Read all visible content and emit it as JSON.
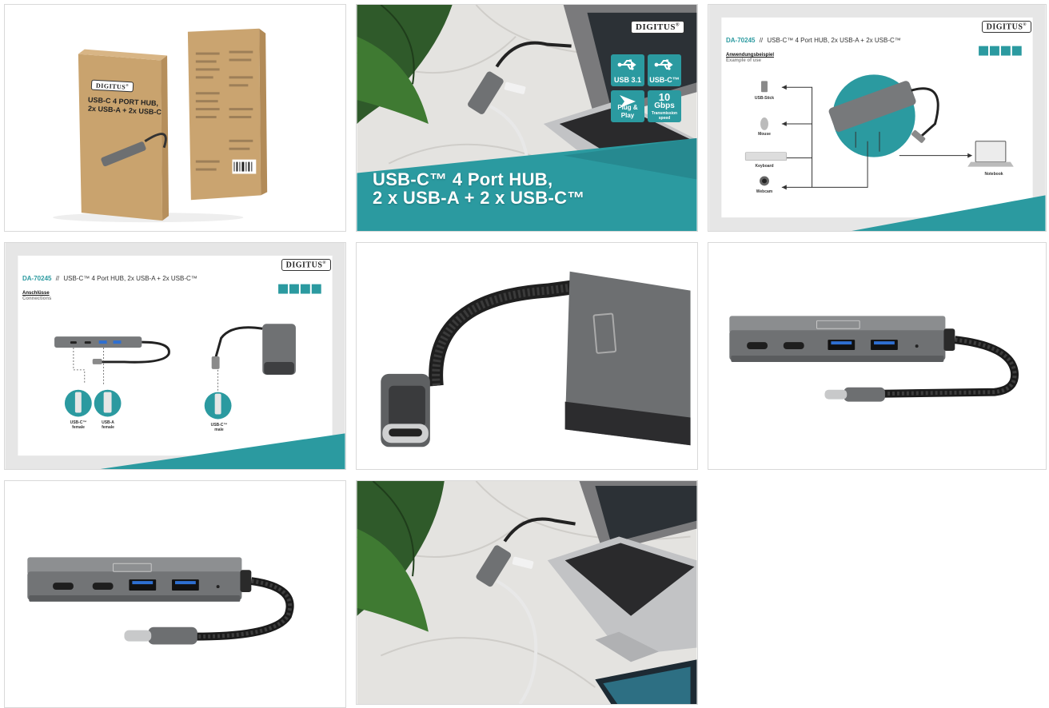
{
  "gallery": {
    "brand": "DIGITUS",
    "tile1": {
      "box_logo": "DIGITUS",
      "box_title": "USB-C 4 PORT HUB,",
      "box_subtitle": "2x USB-A + 2x USB-C"
    },
    "tile2": {
      "headline_line1": "USB-C™ 4 Port HUB,",
      "headline_line2": "2 x USB-A + 2 x USB-C™",
      "badges": [
        {
          "label": "USB 3.1",
          "icon": "usb-icon"
        },
        {
          "label": "USB-C™",
          "icon": "usb-icon"
        },
        {
          "label": "Plug & Play",
          "icon": "plug-and-play-icon"
        },
        {
          "value": "10",
          "unit": "Gbps",
          "label": "Transmission speed"
        }
      ]
    },
    "tile3": {
      "model": "DA-70245",
      "separator": "//",
      "title": "USB-C™ 4 Port HUB, 2x USB-A + 2x USB-C™",
      "heading_de": "Anwendungsbeispiel",
      "heading_en": "Example of use",
      "devices": [
        "USB-Stick",
        "Mouse",
        "Keyboard",
        "Webcam"
      ],
      "host": "Notebook"
    },
    "tile4": {
      "model": "DA-70245",
      "separator": "//",
      "title": "USB-C™ 4 Port HUB, 2x USB-A + 2x USB-C™",
      "heading_de": "Anschlüsse",
      "heading_en": "Connections",
      "connectors": [
        {
          "line1": "USB-C™",
          "line2": "female"
        },
        {
          "line1": "USB-A",
          "line2": "female"
        },
        {
          "line1": "USB-C™",
          "line2": "male"
        }
      ]
    }
  },
  "colors": {
    "accent": "#2b9aa0",
    "hub_gray": "#77797b",
    "kraft": "#c9a36e"
  }
}
